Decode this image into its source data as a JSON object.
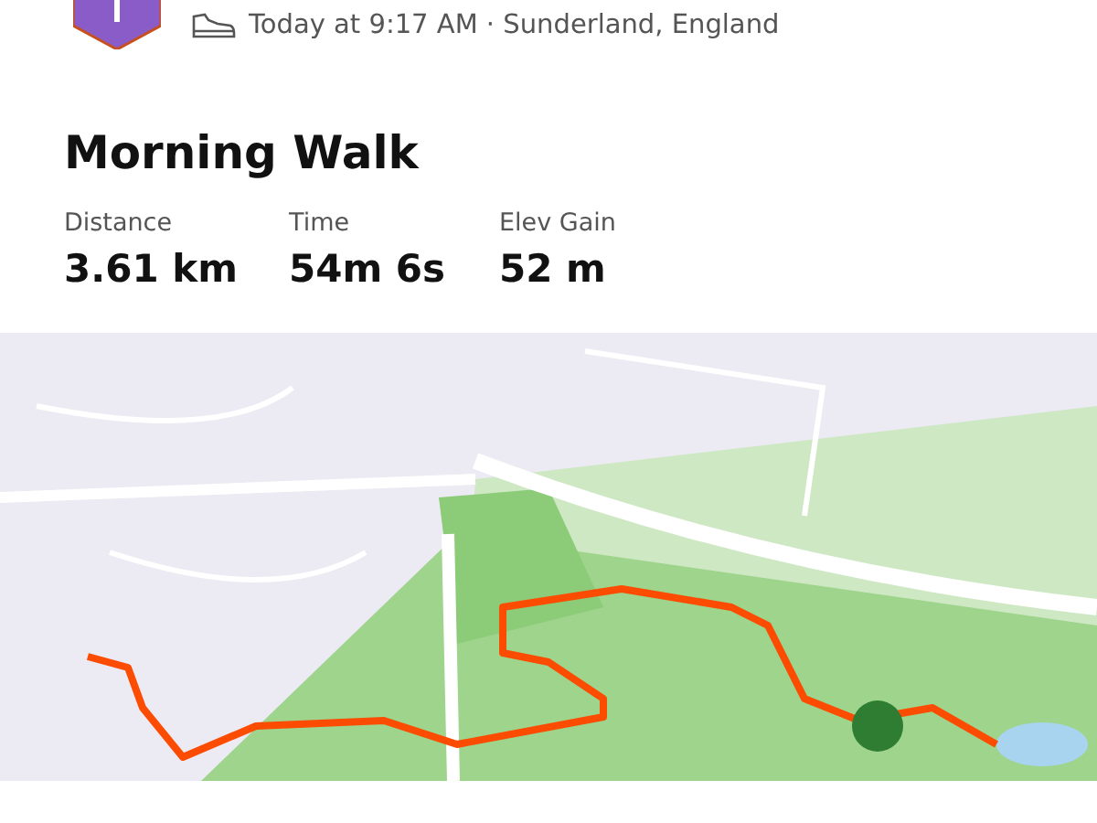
{
  "activity": {
    "meta": "Today at 9:17 AM · Sunderland, England",
    "title": "Morning Walk"
  },
  "stats": [
    {
      "label": "Distance",
      "value": "3.61 km"
    },
    {
      "label": "Time",
      "value": "54m 6s"
    },
    {
      "label": "Elev Gain",
      "value": "52 m"
    }
  ]
}
